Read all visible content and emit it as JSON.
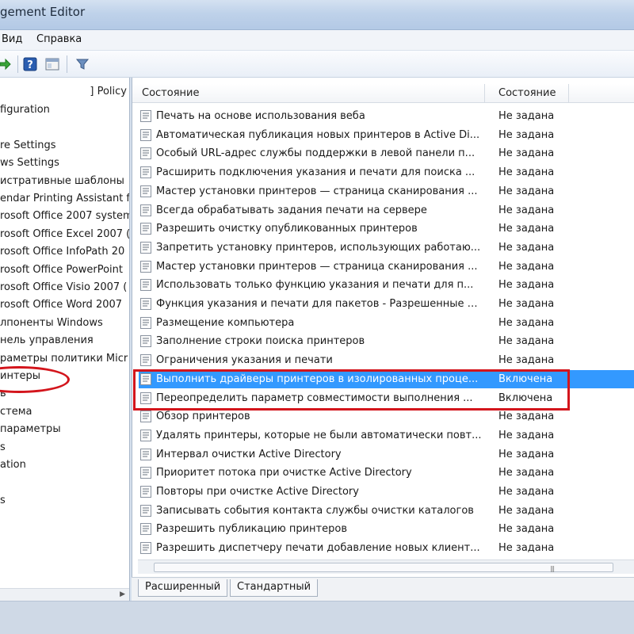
{
  "window": {
    "title": "gement Editor"
  },
  "menu": {
    "view": "Вид",
    "help": "Справка"
  },
  "toolbar": {
    "buttons": [
      {
        "name": "forward-icon"
      },
      {
        "name": "help-icon"
      },
      {
        "name": "console-icon"
      },
      {
        "name": "filter-icon"
      }
    ]
  },
  "tree": {
    "header": "] Policy",
    "items": [
      "figuration",
      "",
      "re Settings",
      "ws Settings",
      "истративные шаблоны",
      "endar Printing Assistant f",
      "rosoft Office 2007 system",
      "rosoft Office Excel 2007 (",
      "rosoft Office InfoPath 20",
      "rosoft Office PowerPoint",
      "rosoft Office Visio 2007 (",
      "rosoft Office Word 2007",
      "лпоненты Windows",
      "нель управления",
      "раметры политики Micr",
      "интеры",
      "ь",
      "стема",
      "параметры",
      "s",
      "ation",
      "",
      "s"
    ]
  },
  "list": {
    "columns": {
      "name": "Состояние",
      "state": "Состояние"
    },
    "rows": [
      {
        "name": "Печать на основе использования веба",
        "state": "Не задана"
      },
      {
        "name": "Автоматическая публикация новых принтеров в Active Di...",
        "state": "Не задана"
      },
      {
        "name": "Особый URL-адрес службы поддержки в левой панели п...",
        "state": "Не задана"
      },
      {
        "name": "Расширить подключения указания и печати для поиска ...",
        "state": "Не задана"
      },
      {
        "name": "Мастер установки принтеров — страница сканирования ...",
        "state": "Не задана"
      },
      {
        "name": "Всегда обрабатывать задания печати на сервере",
        "state": "Не задана"
      },
      {
        "name": "Разрешить очистку опубликованных принтеров",
        "state": "Не задана"
      },
      {
        "name": "Запретить установку принтеров, использующих работаю...",
        "state": "Не задана"
      },
      {
        "name": "Мастер установки принтеров — страница сканирования ...",
        "state": "Не задана"
      },
      {
        "name": "Использовать только функцию указания и печати для п...",
        "state": "Не задана"
      },
      {
        "name": "Функция указания и печати для пакетов - Разрешенные с...",
        "state": "Не задана"
      },
      {
        "name": "Размещение компьютера",
        "state": "Не задана"
      },
      {
        "name": "Заполнение строки поиска принтеров",
        "state": "Не задана"
      },
      {
        "name": "Ограничения указания и печати",
        "state": "Не задана"
      },
      {
        "name": "Выполнить драйверы принтеров в изолированных проце...",
        "state": "Включена",
        "selected": true
      },
      {
        "name": "Переопределить параметр совместимости выполнения ...",
        "state": "Включена"
      },
      {
        "name": "Обзор принтеров",
        "state": "Не задана"
      },
      {
        "name": "Удалять принтеры, которые не были автоматически повт...",
        "state": "Не задана"
      },
      {
        "name": "Интервал очистки Active Directory",
        "state": "Не задана"
      },
      {
        "name": "Приоритет потока при очистке Active Directory",
        "state": "Не задана"
      },
      {
        "name": "Повторы при очистке Active Directory",
        "state": "Не задана"
      },
      {
        "name": "Записывать события контакта службы очистки каталогов",
        "state": "Не задана"
      },
      {
        "name": "Разрешить публикацию принтеров",
        "state": "Не задана"
      },
      {
        "name": "Разрешить диспетчеру печати добавление новых клиент...",
        "state": "Не задана"
      }
    ]
  },
  "tabs": {
    "extended": "Расширенный",
    "standard": "Стандартный"
  },
  "colors": {
    "selection": "#3399ff",
    "annotation": "#d3151c"
  }
}
